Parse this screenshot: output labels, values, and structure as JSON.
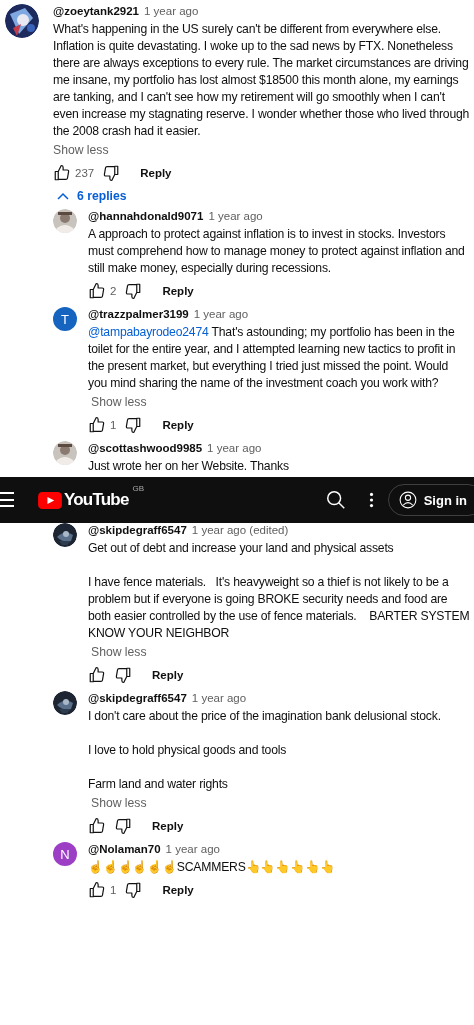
{
  "comment": {
    "author": "@zoeytank2921",
    "time": "1 year ago",
    "body": "What's happening in the US surely can't be different from everywhere else. Inflation is quite devastating. I woke up to the sad news by FTX. Nonetheless there are always exceptions to every rule. The market circumstances are driving me insane, my portfolio has lost almost $18500 this month alone, my earnings are tanking, and I can't see how my retirement will go smoothly when I can't even increase my stagnating reserve. I wonder whether those who lived through the 2008 crash had it easier.",
    "show_less": "Show less",
    "likes": "237",
    "reply": "Reply"
  },
  "replies_toggle": {
    "label": "6 replies",
    "expanded": true
  },
  "replies": [
    {
      "author": "@hannahdonald9071",
      "time": "1 year ago",
      "body": "A approach to protect against inflation is to invest in stocks. Investors must comprehend how to manage money to protect against inflation and still make money, especially during recessions.",
      "likes": "2",
      "reply": "Reply"
    },
    {
      "author": "@trazzpalmer3199",
      "time": "1 year ago",
      "avatar": {
        "kind": "letter",
        "letter": "T",
        "color": "#1565c0"
      },
      "mention": "@tampabayrodeo2474",
      "body": "That's astounding; my portfolio has been in the toilet for the entire year, and I attempted learning new tactics to profit in the present market, but everything I tried just missed the point. Would you mind sharing the name of the investment coach you work with?",
      "show_less": "Show less",
      "likes": "1",
      "reply": "Reply"
    },
    {
      "author": "@scottashwood9985",
      "time": "1 year ago",
      "body": "Just wrote her on her Website. Thanks"
    }
  ],
  "header": {
    "menu": "☰",
    "logo": "YouTube",
    "region": "GB",
    "sign_in": "Sign in"
  },
  "replies_continued": [
    {
      "author": "@skipdegraff6547",
      "time": "1 year ago (edited)",
      "body": "Get out of debt and increase your land and physical assets\n\nI have fence materials.   It's heavyweight so a thief is not likely to be a problem but if everyone is going BROKE security needs and food are both easier controlled by the use of fence materials.    BARTER SYSTEM\nKNOW YOUR NEIGHBOR",
      "show_less": "Show less",
      "reply": "Reply"
    },
    {
      "author": "@skipdegraff6547",
      "time": "1 year ago",
      "body": "I don't care about the price of the imagination bank delusional stock.\n\nI love to hold physical goods and tools\n\nFarm land and water rights",
      "show_less": "Show less",
      "reply": "Reply"
    },
    {
      "author": "@Nolaman70",
      "time": "1 year ago",
      "avatar": {
        "kind": "letter",
        "letter": "N",
        "color": "#9c3fc4"
      },
      "body": "☝☝☝☝☝☝SCAMMERS👆👆👆👆👆👆",
      "likes": "1",
      "reply": "Reply"
    }
  ]
}
